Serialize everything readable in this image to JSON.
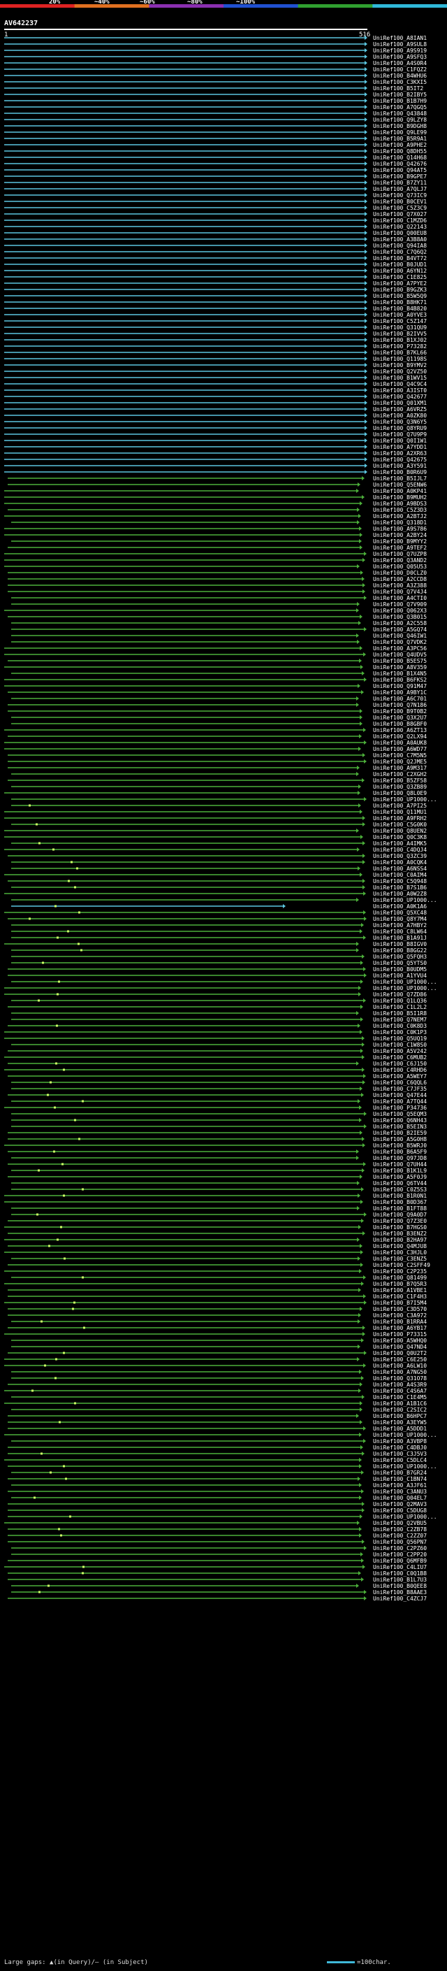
{
  "scale": {
    "colors": [
      "#dd2222",
      "#e07020",
      "#8a2fb0",
      "#2050d0",
      "#30a030",
      "#30b8d8"
    ],
    "ticks": [
      "20%",
      "~40%",
      "~60%",
      "~80%",
      "~100%"
    ]
  },
  "query": {
    "name": "AV642237",
    "start": "1",
    "end": "516"
  },
  "hit_colors": {
    "high": "#5cc6e0",
    "mid": "#4caf3a",
    "gap_marker": "#ccff66"
  },
  "hits": [
    "UniRef100_A8IAN1",
    "UniRef100_A9SUL8",
    "UniRef100_A9S919",
    "UniRef100_A9SFQ3",
    "UniRef100_A4S0R4",
    "UniRef100_C1FQZ2",
    "UniRef100_B4WHU6",
    "UniRef100_C3KXI5",
    "UniRef100_B5IT2",
    "UniRef100_B2IBY5",
    "UniRef100_B1B7H9",
    "UniRef100_A7QGQ5",
    "UniRef100_Q43848",
    "UniRef100_Q9LZY8",
    "UniRef100_B9DGH8",
    "UniRef100_Q9LE99",
    "UniRef100_B5R9A1",
    "UniRef100_A9PHE2",
    "UniRef100_Q8DH55",
    "UniRef100_Q14H68",
    "UniRef100_Q42676",
    "UniRef100_Q94AT5",
    "UniRef100_B9GPE7",
    "UniRef100_B7ZY11",
    "UniRef100_A7QLJ7",
    "UniRef100_Q73IC9",
    "UniRef100_B0CEV1",
    "UniRef100_C5Z3C9",
    "UniRef100_Q7X027",
    "UniRef100_C1MZD6",
    "UniRef100_Q22143",
    "UniRef100_Q00EU8",
    "UniRef100_A3B8A0",
    "UniRef100_Q94IA8",
    "UniRef100_C7Q6Q2",
    "UniRef100_B4VT72",
    "UniRef100_B0JUD1",
    "UniRef100_A6YN12",
    "UniRef100_C1E825",
    "UniRef100_A7PYE2",
    "UniRef100_B9GZK3",
    "UniRef100_B5W5Q9",
    "UniRef100_B8HK71",
    "UniRef100_B4B820",
    "UniRef100_A0YVE3",
    "UniRef100_C5Z147",
    "UniRef100_Q31QU9",
    "UniRef100_B2IVV5",
    "UniRef100_B1XJ02",
    "UniRef100_P73282",
    "UniRef100_B7KL66",
    "UniRef100_Q1198S",
    "UniRef100_B9YMV2",
    "UniRef100_Q2VZ50",
    "UniRef100_B1WV15",
    "UniRef100_Q4C9C4",
    "UniRef100_A3IST0",
    "UniRef100_Q42677",
    "UniRef100_Q01XM1",
    "UniRef100_A6VRZ5",
    "UniRef100_A0ZK80",
    "UniRef100_Q3N6Y5",
    "UniRef100_Q8YRU9",
    "UniRef100_Q7U9P9",
    "UniRef100_Q0I1W1",
    "UniRef100_A7YDD1",
    "UniRef100_A2XR63",
    "UniRef100_Q42675",
    "UniRef100_A3Y591",
    "UniRef100_B0R6U9",
    "UniRef100_B5IJL7",
    "UniRef100_Q5ENW6",
    "UniRef100_A0KP41",
    "UniRef100_B9MUH2",
    "UniRef100_A9BDS3",
    "UniRef100_C5Z3D3",
    "UniRef100_A2BTJ2",
    "UniRef100_Q318D1",
    "UniRef100_A9S786",
    "UniRef100_A2BY24",
    "UniRef100_B9MYY2",
    "UniRef100_A9TEF2",
    "UniRef100_Q7UZP8",
    "UniRef100_Q3AND2",
    "UniRef100_Q05U53",
    "UniRef100_D0CLZ0",
    "UniRef100_A2CCD8",
    "UniRef100_A3Z388",
    "UniRef100_Q7V4J4",
    "UniRef100_A4CTI0",
    "UniRef100_Q7V909",
    "UniRef100_Q062X3",
    "UniRef100_Q3B015",
    "UniRef100_A2C558",
    "UniRef100_A5GQ74",
    "UniRef100_Q46IW1",
    "UniRef100_Q7VDK2",
    "UniRef100_A3PC56",
    "UniRef100_Q4UDV5",
    "UniRef100_B5ES75",
    "UniRef100_A8V359",
    "UniRef100_B1X4N5",
    "UniRef100_B6FKS2",
    "UniRef100_Q91M47",
    "UniRef100_A9BY1C",
    "UniRef100_A6C701",
    "UniRef100_Q7N186",
    "UniRef100_B9T0B2",
    "UniRef100_Q3X2U7",
    "UniRef100_B8GBF0",
    "UniRef100_A6ZT13",
    "UniRef100_Q2LX94",
    "UniRef100_A0AUK8",
    "UniRef100_A6WD77",
    "UniRef100_C7M5N5",
    "UniRef100_Q2JME5",
    "UniRef100_A9M317",
    "UniRef100_C2XGH2",
    "UniRef100_B5ZF58",
    "UniRef100_Q3ZB89",
    "UniRef100_Q8L0E9",
    "UniRef100_UP1000...",
    "UniRef100_A7PI25",
    "UniRef100_Q11MU1",
    "UniRef100_A9FRH2",
    "UniRef100_C5G0K0",
    "UniRef100_Q8UEN2",
    "UniRef100_Q0C3K8",
    "UniRef100_A4IMK5",
    "UniRef100_C4DQJ4",
    "UniRef100_Q3ZC39",
    "UniRef100_A0CQK4",
    "UniRef100_A6NSS4",
    "UniRef100_C0AIM4",
    "UniRef100_C5Q948",
    "UniRef100_B7S1B6",
    "UniRef100_A0W2Z8",
    "UniRef100_UP1000...",
    "UniRef100_A0K1A6",
    "UniRef100_Q5XC48",
    "UniRef100_Q8Y7M4",
    "UniRef100_A7HBY2",
    "UniRef100_C8LW64",
    "UniRef100_B1A91J",
    "UniRef100_B8IGV0",
    "UniRef100_B8GG22",
    "UniRef100_Q5FQH3",
    "UniRef100_Q5YTS0",
    "UniRef100_B0UDM5",
    "UniRef100_A1YVU4",
    "UniRef100_UP1000...",
    "UniRef100_UP1000...",
    "UniRef100_Q7ZD86",
    "UniRef100_Q1LQ36",
    "UniRef100_C1L2L2",
    "UniRef100_B5I1R8",
    "UniRef100_Q7NEM7",
    "UniRef100_C0K8D3",
    "UniRef100_C0K1P3",
    "UniRef100_Q5UQ19",
    "UniRef100_C1W8S0",
    "UniRef100_A5V242",
    "UniRef100_C6MUB2",
    "UniRef100_C6J150",
    "UniRef100_C4RHD6",
    "UniRef100_A5WEY7",
    "UniRef100_C6QQL6",
    "UniRef100_C7JF35",
    "UniRef100_Q47E44",
    "UniRef100_A7TQ44",
    "UniRef100_P34736",
    "UniRef100_Q5EQM3",
    "UniRef100_Q6NH43",
    "UniRef100_B5EIN3",
    "UniRef100_B2IE59",
    "UniRef100_A5G0H8",
    "UniRef100_B5WRJ0",
    "UniRef100_B6A5F9",
    "UniRef100_Q97JD8",
    "UniRef100_Q7UH44",
    "UniRef100_B1K1L9",
    "UniRef100_A5F0J9",
    "UniRef100_Q6TV44",
    "UniRef100_C0Z5S3",
    "UniRef100_B1R0N1",
    "UniRef100_B0D367",
    "UniRef100_B1FT88",
    "UniRef100_Q9A0D7",
    "UniRef100_Q7Z3E0",
    "UniRef100_B7HGS0",
    "UniRef100_B3ENZ2",
    "UniRef100_B2HA97",
    "UniRef100_Q4MJU8",
    "UniRef100_C3HJL0",
    "UniRef100_C3ENZ5",
    "UniRef100_C2SFF49",
    "UniRef100_C2P235",
    "UniRef100_Q81499",
    "UniRef100_B7Q5R3",
    "UniRef100_A1VBE1",
    "UniRef100_C1F4H3",
    "UniRef100_B7I5M4",
    "UniRef100_C3D570",
    "UniRef100_C3A972",
    "UniRef100_B1RRA4",
    "UniRef100_A6YB17",
    "UniRef100_P73315",
    "UniRef100_A5WHQ0",
    "UniRef100_Q47ND4",
    "UniRef100_Q0U2T2",
    "UniRef100_C6E250",
    "UniRef100_A6LW10",
    "UniRef100_A7NG50",
    "UniRef100_Q31O78",
    "UniRef100_A4S3R9",
    "UniRef100_C4S6A7",
    "UniRef100_C1E4M5",
    "UniRef100_A1B1C6",
    "UniRef100_C2SIC2",
    "UniRef100_B6HPC7",
    "UniRef100_A3EYW5",
    "UniRef100_A5DDD1",
    "UniRef100_UP1000...",
    "UniRef100_A3VBP8",
    "UniRef100_C4DBJ0",
    "UniRef100_C3J5V3",
    "UniRef100_C5DLC4",
    "UniRef100_UP1000...",
    "UniRef100_B7GR24",
    "UniRef100_C1BN74",
    "UniRef100_A3JF61",
    "UniRef100_C3ANU3",
    "UniRef100_Q04EL7",
    "UniRef100_Q2MAV3",
    "UniRef100_C5DUG8",
    "UniRef100_UP1000...",
    "UniRef100_Q2VBU5",
    "UniRef100_C2ZB78",
    "UniRef100_C2ZZ07",
    "UniRef100_Q56PN7",
    "UniRef100_C2PZ60",
    "UniRef100_C2PP20",
    "UniRef100_Q6MFB9",
    "UniRef100_C4LIU7",
    "UniRef100_C0Q1B8",
    "UniRef100_B1L7U3",
    "UniRef100_B0QEE8",
    "UniRef100_B8AAE3",
    "UniRef100_C4ZCJ7"
  ],
  "footer": {
    "gaps_text": "Large gaps: ▲(in Query)/– (in Subject)",
    "legend_text": "=100char."
  }
}
